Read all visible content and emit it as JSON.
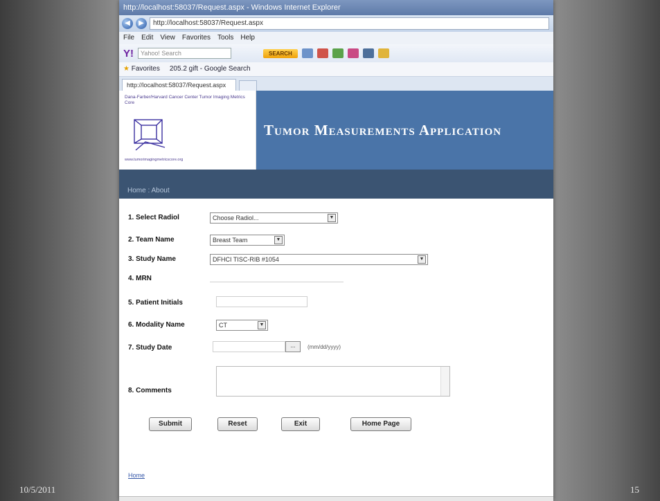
{
  "slide": {
    "date": "10/5/2011",
    "number": "15"
  },
  "browser": {
    "title": "http://localhost:58037/Request.aspx - Windows Internet Explorer",
    "address": "http://localhost:58037/Request.aspx",
    "menu": [
      "File",
      "Edit",
      "View",
      "Favorites",
      "Tools",
      "Help"
    ],
    "toolbar": {
      "search_placeholder": "Yahoo! Search",
      "search_button": "SEARCH"
    },
    "favorites": {
      "label": "Favorites",
      "link": "205.2 gift - Google Search"
    },
    "tab": "http://localhost:58037/Request.aspx"
  },
  "app": {
    "logo_top": "Dana-Farber/Harvard Cancer Center Tumor Imaging Metrics Core",
    "logo_bottom": "www.tumorimagingmetricscore.org",
    "title": "Tumor Measurements Application",
    "breadcrumb": "Home : About"
  },
  "form": {
    "fields": [
      {
        "label": "1. Select Radiol",
        "value": "Choose Radiol..."
      },
      {
        "label": "2. Team Name",
        "value": "Breast Team"
      },
      {
        "label": "3. Study Name",
        "value": "DFHCI TISC-RIB #1054"
      },
      {
        "label": "4. MRN",
        "value": ""
      },
      {
        "label": "5. Patient Initials",
        "value": ""
      },
      {
        "label": "6. Modality Name",
        "value": "CT"
      },
      {
        "label": "7. Study Date",
        "value": "",
        "hint": "(mm/dd/yyyy)"
      },
      {
        "label": "8. Comments",
        "value": ""
      }
    ],
    "buttons": {
      "submit": "Submit",
      "reset": "Reset",
      "exit": "Exit",
      "home": "Home Page"
    },
    "home_link": "Home"
  }
}
